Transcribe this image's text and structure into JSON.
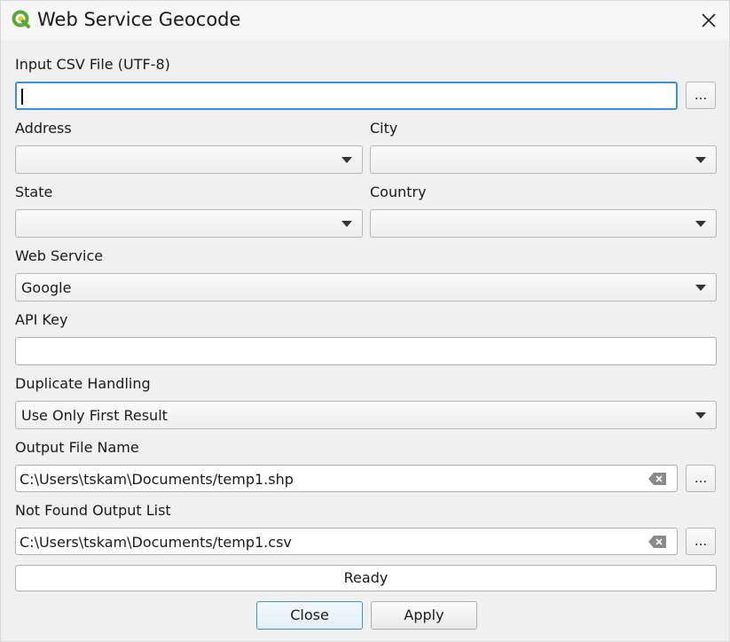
{
  "window": {
    "title": "Web Service Geocode"
  },
  "input_csv": {
    "label": "Input CSV File (UTF-8)",
    "value": "",
    "browse_label": "..."
  },
  "address": {
    "label": "Address",
    "value": ""
  },
  "city": {
    "label": "City",
    "value": ""
  },
  "state": {
    "label": "State",
    "value": ""
  },
  "country": {
    "label": "Country",
    "value": ""
  },
  "web_service": {
    "label": "Web Service",
    "value": "Google"
  },
  "api_key": {
    "label": "API Key",
    "value": ""
  },
  "duplicate_handling": {
    "label": "Duplicate Handling",
    "value": "Use Only First Result"
  },
  "output_file": {
    "label": "Output File Name",
    "value": "C:\\Users\\tskam\\Documents/temp1.shp",
    "browse_label": "..."
  },
  "not_found": {
    "label": "Not Found Output List",
    "value": "C:\\Users\\tskam\\Documents/temp1.csv",
    "browse_label": "..."
  },
  "status": {
    "text": "Ready"
  },
  "buttons": {
    "close": "Close",
    "apply": "Apply"
  },
  "colors": {
    "focus": "#3f8fd6",
    "qgis_green": "#5aa838",
    "qgis_yellow": "#f0c419"
  }
}
